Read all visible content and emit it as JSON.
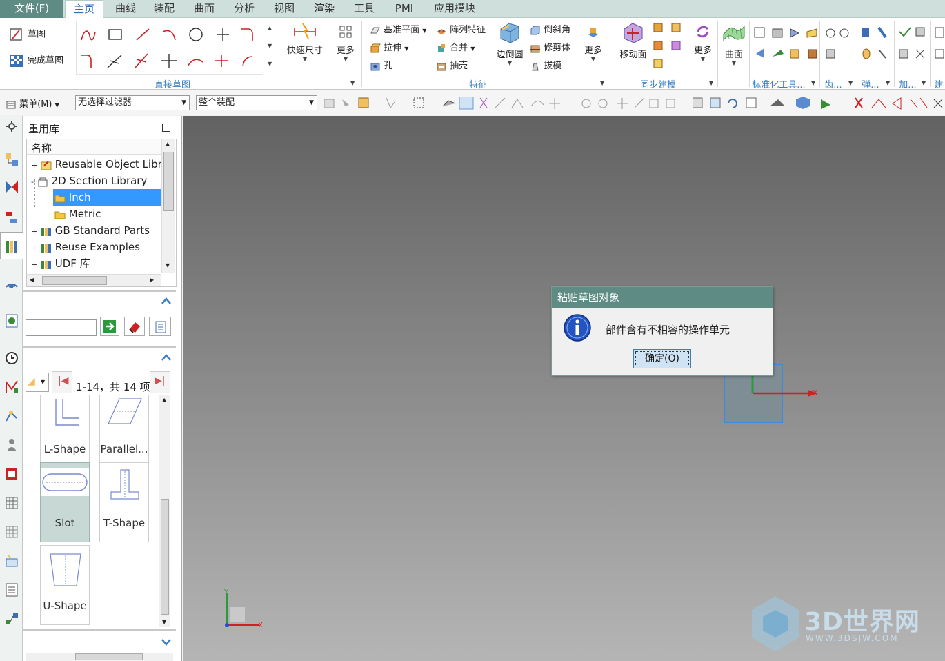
{
  "menubar": {
    "tabs": [
      "文件(F)",
      "主页",
      "曲线",
      "装配",
      "曲面",
      "分析",
      "视图",
      "渲染",
      "工具",
      "PMI",
      "应用模块"
    ]
  },
  "ribbon": {
    "sketch_label": "草图",
    "finish_sketch_label": "完成草图",
    "quick_dim_label": "快速尺寸",
    "more1_label": "更多",
    "group_direct_sketch": "直接草图",
    "datum_plane_label": "基准平面",
    "extrude_label": "拉伸",
    "hole_label": "孔",
    "pattern_label": "阵列特征",
    "unite_label": "合并",
    "shell_label": "抽壳",
    "edge_blend_label": "边倒圆",
    "chamfer_label": "倒斜角",
    "trim_body_label": "修剪体",
    "draft_label": "拔模",
    "more2_label": "更多",
    "group_feature": "特征",
    "move_face_label": "移动面",
    "more3_label": "更多",
    "group_sync": "同步建模",
    "surface_label": "曲面",
    "group_std_tools": "标准化工具...",
    "group_gear": "齿...",
    "group_spring": "弹...",
    "group_add": "加...",
    "group_build": "建"
  },
  "toolbar2": {
    "menu_label": "菜单(M)",
    "filter_value": "无选择过滤器",
    "scope_value": "整个装配"
  },
  "panel": {
    "title": "重用库",
    "column_header": "名称",
    "tree": [
      {
        "label": "Reusable Object Libra",
        "expander": "+"
      },
      {
        "label": "2D Section Library",
        "expander": "-"
      },
      {
        "label": "Inch",
        "expander": ""
      },
      {
        "label": "Metric",
        "expander": ""
      },
      {
        "label": "GB Standard Parts",
        "expander": "+"
      },
      {
        "label": "Reuse Examples",
        "expander": "+"
      },
      {
        "label": "UDF 库",
        "expander": "+"
      }
    ],
    "paging_text": "1-14，共 14 项",
    "members": [
      "L-Shape",
      "Parallel...",
      "Slot",
      "T-Shape",
      "U-Shape"
    ]
  },
  "dialog": {
    "title": "粘贴草图对象",
    "message": "部件含有不相容的操作单元",
    "ok_label": "确定(O)"
  },
  "watermark": {
    "brand": "3D世界网",
    "url": "WWW.3DSJW.COM"
  },
  "axis_labels": {
    "x": "X",
    "y": "Y"
  },
  "colors": {
    "title_bar": "#5e8b84",
    "accent_blue": "#2a6fbf",
    "selection": "#3399ff"
  }
}
